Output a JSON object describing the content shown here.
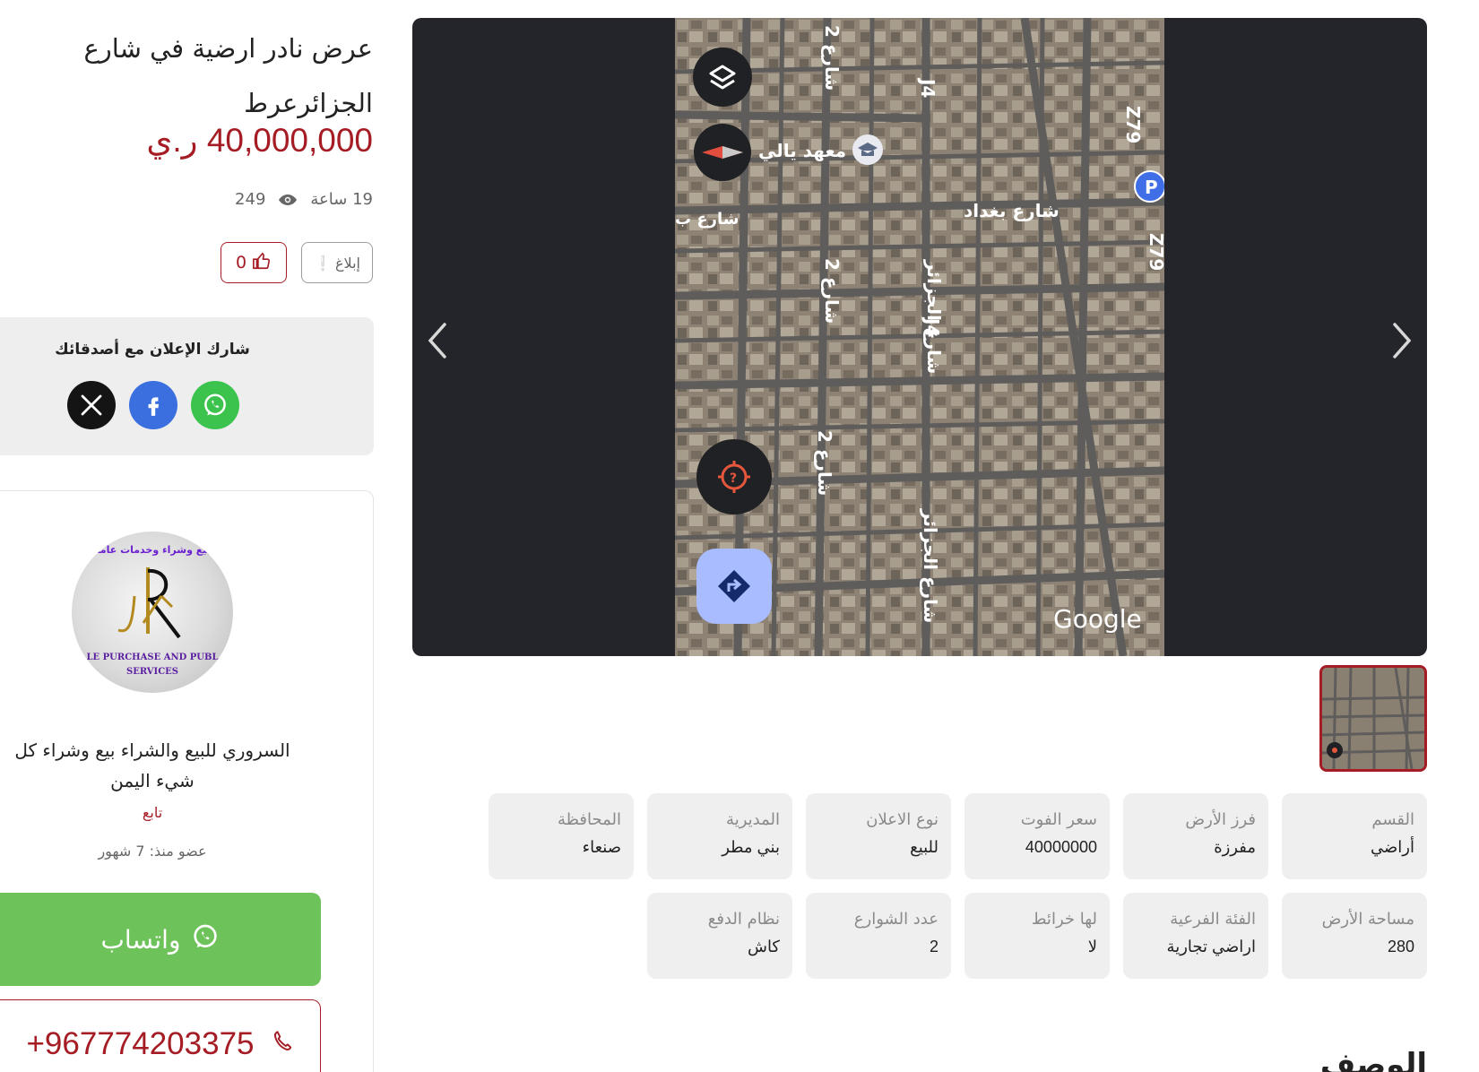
{
  "listing": {
    "title": "عرض نادر ارضية في شارع الجزائرعرط",
    "price": "40,000,000 ر.ي",
    "posted": "19 ساعة",
    "views": "249",
    "report_label": "إبلاغ",
    "likes": "0"
  },
  "share": {
    "title": "شارك الإعلان مع أصدقائك",
    "icons": [
      "x-icon",
      "facebook-icon",
      "whatsapp-icon"
    ]
  },
  "seller": {
    "avatar_top_text": "بيع وشراء وخدمات عامة",
    "avatar_bottom_text": "LE PURCHASE AND PUBL SERVICES",
    "name": "السروري للبيع والشراء بيع وشراء كل شيء اليمن",
    "follow_label": "تابع",
    "member_since": "عضو منذ: 7 شهور",
    "whatsapp_label": "واتساب",
    "phone": "+967774203375"
  },
  "gallery": {
    "map_labels": {
      "street_algeria_1": "شارع الجزائر",
      "street_algeria_2": "شارع الجزائر",
      "street_baghdad": "شارع بغداد",
      "institute": "معهد يالي",
      "street2_a": "شارع 2",
      "street2_b": "شارع 2",
      "street2_c": "شارع 2",
      "street_left": "شارع ب",
      "j4_a": "J4",
      "j4_b": "J4",
      "z79_a": "Z79",
      "z79_b": "Z79",
      "google": "Google"
    }
  },
  "specs": [
    {
      "label": "القسم",
      "value": "أراضي"
    },
    {
      "label": "فرز الأرض",
      "value": "مفرزة"
    },
    {
      "label": "سعر الفوت",
      "value": "40000000"
    },
    {
      "label": "نوع الاعلان",
      "value": "للبيع"
    },
    {
      "label": "المديرية",
      "value": "بني مطر"
    },
    {
      "label": "المحافظة",
      "value": "صنعاء"
    },
    {
      "label": "مساحة الأرض",
      "value": "280"
    },
    {
      "label": "الفئة الفرعية",
      "value": "اراضي تجارية"
    },
    {
      "label": "لها خرائط",
      "value": "لا"
    },
    {
      "label": "عدد الشوارع",
      "value": "2"
    },
    {
      "label": "نظام الدفع",
      "value": "كاش"
    }
  ],
  "description_heading": "الوصف",
  "colors": {
    "accent": "#a51c24",
    "whatsapp": "#6ec25a",
    "card_bg": "#efefef",
    "gallery_bg": "#24252a"
  }
}
